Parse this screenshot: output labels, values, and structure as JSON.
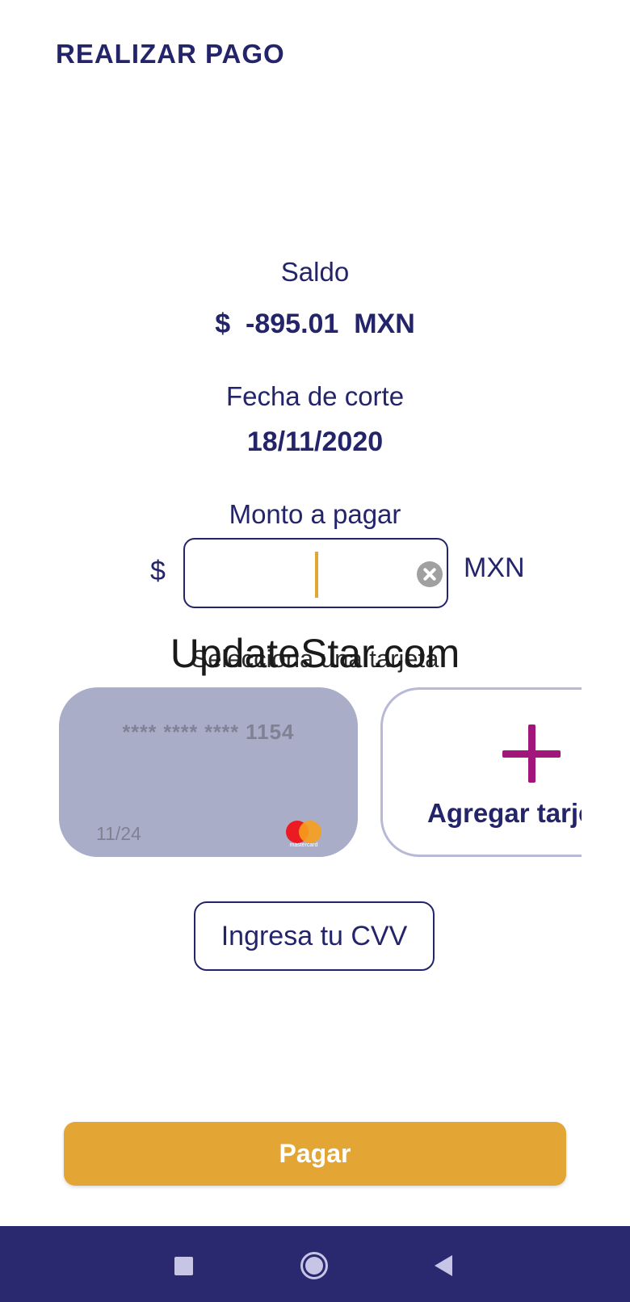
{
  "header": {
    "title": "REALIZAR PAGO"
  },
  "balance": {
    "label": "Saldo",
    "value": "$  -895.01  MXN"
  },
  "cutoff": {
    "label": "Fecha de corte",
    "value": "18/11/2020"
  },
  "amount": {
    "label": "Monto a pagar",
    "prefix": "$",
    "suffix": "MXN",
    "value": ""
  },
  "card_section": {
    "label": "Selecciona una tarjeta"
  },
  "watermark": "UpdateStar.com",
  "cards": [
    {
      "masked": "**** **** ****",
      "last4": "1154",
      "expiry": "11/24",
      "brand": "mastercard"
    }
  ],
  "add_card": {
    "label": "Agregar tarjeta"
  },
  "cvv": {
    "label": "Ingresa tu CVV"
  },
  "pay": {
    "label": "Pagar"
  },
  "colors": {
    "primary": "#24246b",
    "accent": "#e3a534",
    "plus": "#a2157a",
    "card": "#a9adc8",
    "navbar": "#2a286f"
  }
}
